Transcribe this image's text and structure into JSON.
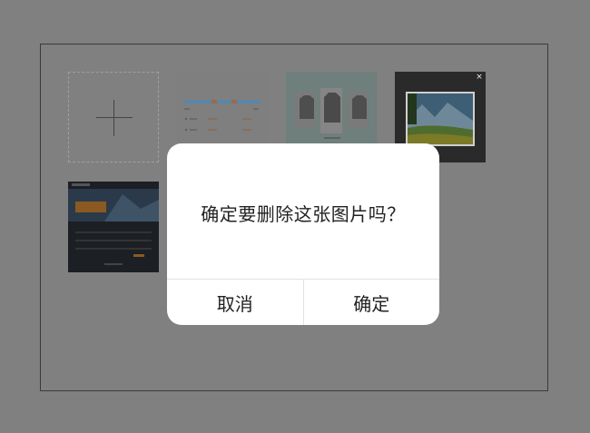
{
  "gallery": {
    "add_icon": "plus-icon",
    "thumbnails": [
      {
        "name": "pricing-table-image",
        "description_icon": "image-icon"
      },
      {
        "name": "tshirt-product-image",
        "description_icon": "image-icon"
      },
      {
        "name": "landscape-lightbox-image",
        "description_icon": "image-icon",
        "close_icon": "close-icon",
        "close_glyph": "×"
      },
      {
        "name": "architecture-website-image",
        "description_icon": "image-icon"
      }
    ]
  },
  "dialog": {
    "message": "确定要删除这张图片吗？",
    "cancel_label": "取消",
    "confirm_label": "确定"
  },
  "colors": {
    "overlay": "#808080",
    "dialog_bg": "#ffffff",
    "divider": "#e2e2e2"
  }
}
